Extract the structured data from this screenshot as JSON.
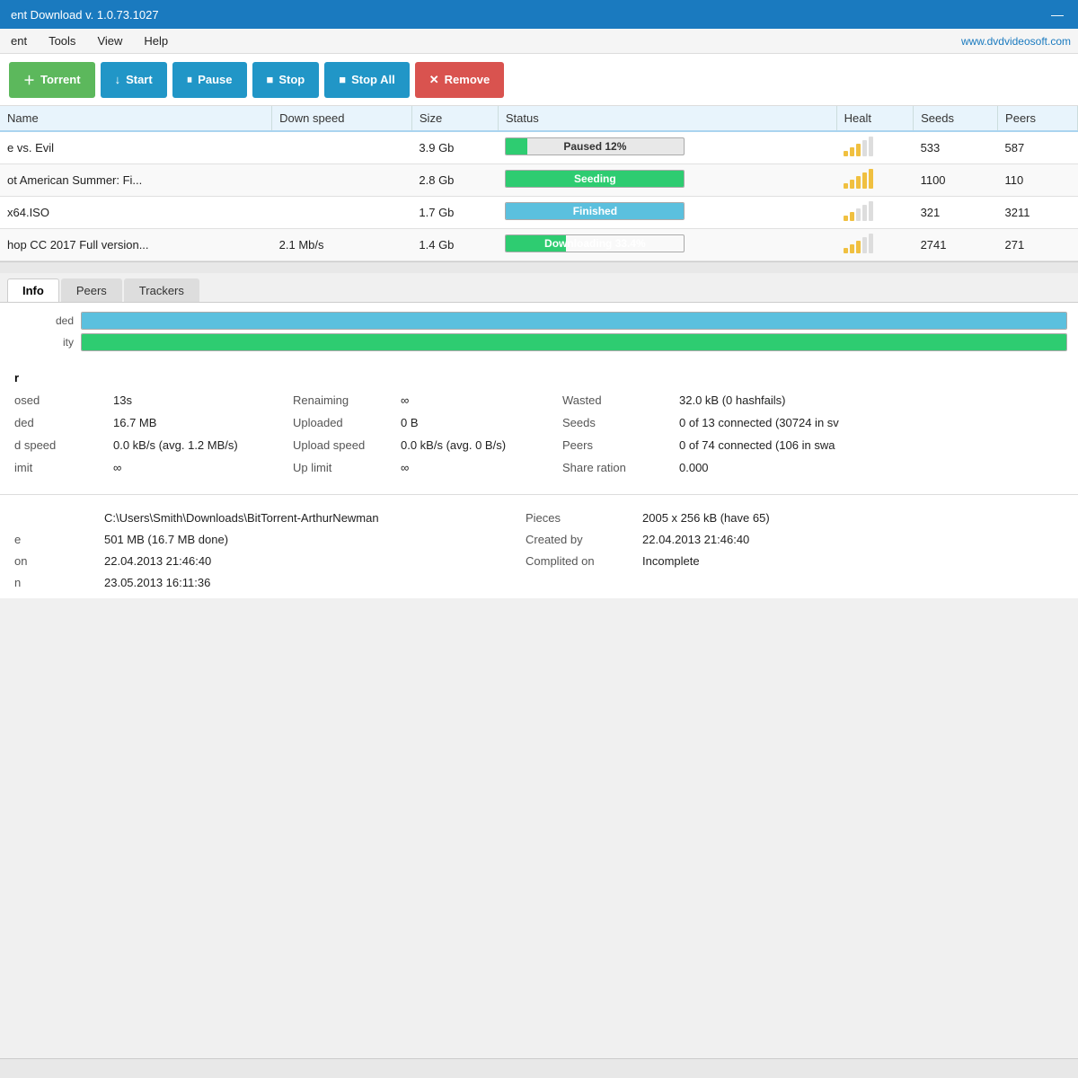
{
  "titleBar": {
    "title": "ent Download v. 1.0.73.1027",
    "minimizeLabel": "—"
  },
  "menuBar": {
    "items": [
      "ent",
      "Tools",
      "View",
      "Help"
    ],
    "websiteLink": "www.dvdvideosoft.com"
  },
  "toolbar": {
    "buttons": [
      {
        "id": "torrent",
        "label": "Torrent",
        "icon": "＋",
        "style": "green"
      },
      {
        "id": "start",
        "label": "Start",
        "icon": "↓",
        "style": "blue"
      },
      {
        "id": "pause",
        "label": "Pause",
        "icon": "⏸",
        "style": "blue"
      },
      {
        "id": "stop",
        "label": "Stop",
        "icon": "■",
        "style": "blue"
      },
      {
        "id": "stop-all",
        "label": "Stop All",
        "icon": "■",
        "style": "blue"
      },
      {
        "id": "remove",
        "label": "Remove",
        "icon": "✕",
        "style": "red"
      }
    ]
  },
  "table": {
    "headers": [
      "Name",
      "Down speed",
      "Size",
      "Status",
      "Healt",
      "Seeds",
      "Peers"
    ],
    "rows": [
      {
        "name": "e vs. Evil",
        "downSpeed": "",
        "size": "3.9 Gb",
        "status": "Paused 12%",
        "statusType": "paused",
        "statusPct": 12,
        "health": [
          3,
          4,
          5,
          0,
          0
        ],
        "seeds": "533",
        "peers": "587"
      },
      {
        "name": "ot American Summer: Fi...",
        "downSpeed": "",
        "size": "2.8 Gb",
        "status": "Seeding",
        "statusType": "seeding",
        "statusPct": 100,
        "health": [
          1,
          1,
          1,
          1,
          1
        ],
        "seeds": "1100",
        "peers": "110"
      },
      {
        "name": "x64.ISO",
        "downSpeed": "",
        "size": "1.7 Gb",
        "status": "Finished",
        "statusType": "finished",
        "statusPct": 100,
        "health": [
          3,
          4,
          0,
          0,
          0
        ],
        "seeds": "321",
        "peers": "3211"
      },
      {
        "name": "hop CC 2017 Full version...",
        "downSpeed": "2.1 Mb/s",
        "size": "1.4 Gb",
        "status": "Downloading 33.4%",
        "statusType": "downloading",
        "statusPct": 33.4,
        "health": [
          1,
          2,
          3,
          0,
          0
        ],
        "seeds": "2741",
        "peers": "271"
      }
    ]
  },
  "tabs": [
    {
      "id": "info",
      "label": "Info",
      "active": true
    },
    {
      "id": "peers",
      "label": "Peers",
      "active": false
    },
    {
      "id": "trackers",
      "label": "Trackers",
      "active": false
    }
  ],
  "progressBars": [
    {
      "label": "ded",
      "type": "blue",
      "pct": 100
    },
    {
      "label": "ity",
      "type": "green",
      "pct": 100
    }
  ],
  "infoSection": {
    "title": "r",
    "fields": [
      {
        "label": "osed",
        "value": "13s"
      },
      {
        "label": "Renaiming",
        "value": "∞"
      },
      {
        "label": "Wasted",
        "value": "32.0 kB (0 hashfails)"
      },
      {
        "label": "ded",
        "value": "16.7 MB"
      },
      {
        "label": "Uploaded",
        "value": "0 B"
      },
      {
        "label": "Seeds",
        "value": "0 of 13 connected (30724 in sv"
      },
      {
        "label": "d speed",
        "value": "0.0 kB/s (avg. 1.2 MB/s)"
      },
      {
        "label": "Upload speed",
        "value": "0.0 kB/s (avg. 0 B/s)"
      },
      {
        "label": "Peers",
        "value": "0 of 74 connected (106 in swa"
      },
      {
        "label": "imit",
        "value": "∞"
      },
      {
        "label": "Up limit",
        "value": "∞"
      },
      {
        "label": "Share ration",
        "value": "0.000"
      }
    ]
  },
  "fileSection": {
    "fields": [
      {
        "label": "",
        "value": "C:\\Users\\Smith\\Downloads\\BitTorrent-ArthurNewman",
        "label2": "Pieces",
        "value2": "2005 x 256 kB (have 65)"
      },
      {
        "label": "e",
        "value": "501 MB (16.7 MB done)",
        "label2": "Created by",
        "value2": "22.04.2013 21:46:40"
      },
      {
        "label": "on",
        "value": "22.04.2013 21:46:40",
        "label2": "Complited on",
        "value2": "Incomplete"
      },
      {
        "label": "n",
        "value": "23.05.2013 16:11:36",
        "label2": "",
        "value2": ""
      }
    ]
  }
}
